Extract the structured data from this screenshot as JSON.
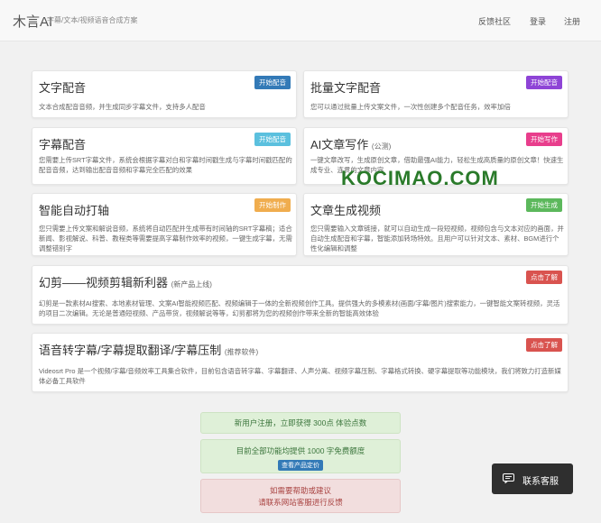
{
  "header": {
    "brand": "木言AI",
    "brand_sub": "字幕/文本/视频语音合成方案",
    "nav": [
      "反馈社区",
      "登录",
      "注册"
    ]
  },
  "cards": [
    {
      "title": "文字配音",
      "tag": "",
      "button": "开始配音",
      "button_color": "#337ab7",
      "desc": "文本合成配音音频，并生成同步字幕文件，支持多人配音"
    },
    {
      "title": "批量文字配音",
      "tag": "",
      "button": "开始配音",
      "button_color": "#8e44d6",
      "desc": "您可以通过批量上传文案文件，一次性创建多个配音任务，效率加倍"
    },
    {
      "title": "字幕配音",
      "tag": "",
      "button": "开始配音",
      "button_color": "#5bc0de",
      "desc": "您需要上传SRT字幕文件，系统会根据字幕对白和字幕时间戳生成与字幕时间戳匹配的配音音频，达到输出配音音频和字幕完全匹配的效果"
    },
    {
      "title": "AI文章写作",
      "tag": "(公测)",
      "button": "开始写作",
      "button_color": "#e83e8c",
      "desc": "一键文章改写，生成原创文章，借助最强AI能力，轻松生成高质量的原创文章！快速生成专业、连贯的文章内容"
    },
    {
      "title": "智能自动打轴",
      "tag": "",
      "button": "开始制作",
      "button_color": "#f0ad4e",
      "desc": "您只需要上传文案和解说音频，系统将自动匹配并生成带有时间轴的SRT字幕稿；适合新闻、影视解说、科普、教程类等需要提高字幕制作效率的视频，一键生成字幕，无需调整错别字"
    },
    {
      "title": "文章生成视频",
      "tag": "",
      "button": "开始生成",
      "button_color": "#5cb85c",
      "desc": "您只需要输入文章链接，就可以自动生成一段短视频，视频包含与文本对应的画面，并自动生成配音和字幕，智能添加转场特效。且用户可以针对文本、素材、BGM进行个性化编辑和调整"
    },
    {
      "title": "幻剪——视频剪辑新利器",
      "tag": "(新产品上线)",
      "button": "点击了解",
      "button_color": "#d9534f",
      "desc": "幻剪是一款素材AI搜索、本地素材管理、文案AI智能视频匹配、视频编辑于一体的全新视频创作工具。提供强大的多模素材(画面/字幕/图片)搜索能力，一键智能文案转视频，灵活的项目二次编辑。无论是普通短视频、产品带货，视频解说等等，幻剪都将为您的视频创作带来全新的智能高效体验"
    },
    {
      "title": "语音转字幕/字幕提取翻译/字幕压制",
      "tag": "(推荐软件)",
      "button": "点击了解",
      "button_color": "#d9534f",
      "desc": "Videosrt Pro 是一个视频/字幕/音频效率工具集合软件，目前包含语音转字幕、字幕翻译、人声分离、视频字幕压制、字幕格式转换、硬字幕提取等功能模块，我们将致力打造新媒体必备工具软件"
    }
  ],
  "info": {
    "register": "新用户注册，立即获得 300点 体验点数",
    "trial": "目前全部功能均提供 1000 字免费额度",
    "price_button": "查看产品定价",
    "help_line1": "如需要帮助或建议",
    "help_line2": "请联系网站客服进行反馈"
  },
  "watermark": "KOCIMAO.COM",
  "contact": {
    "label": "联系客服"
  }
}
